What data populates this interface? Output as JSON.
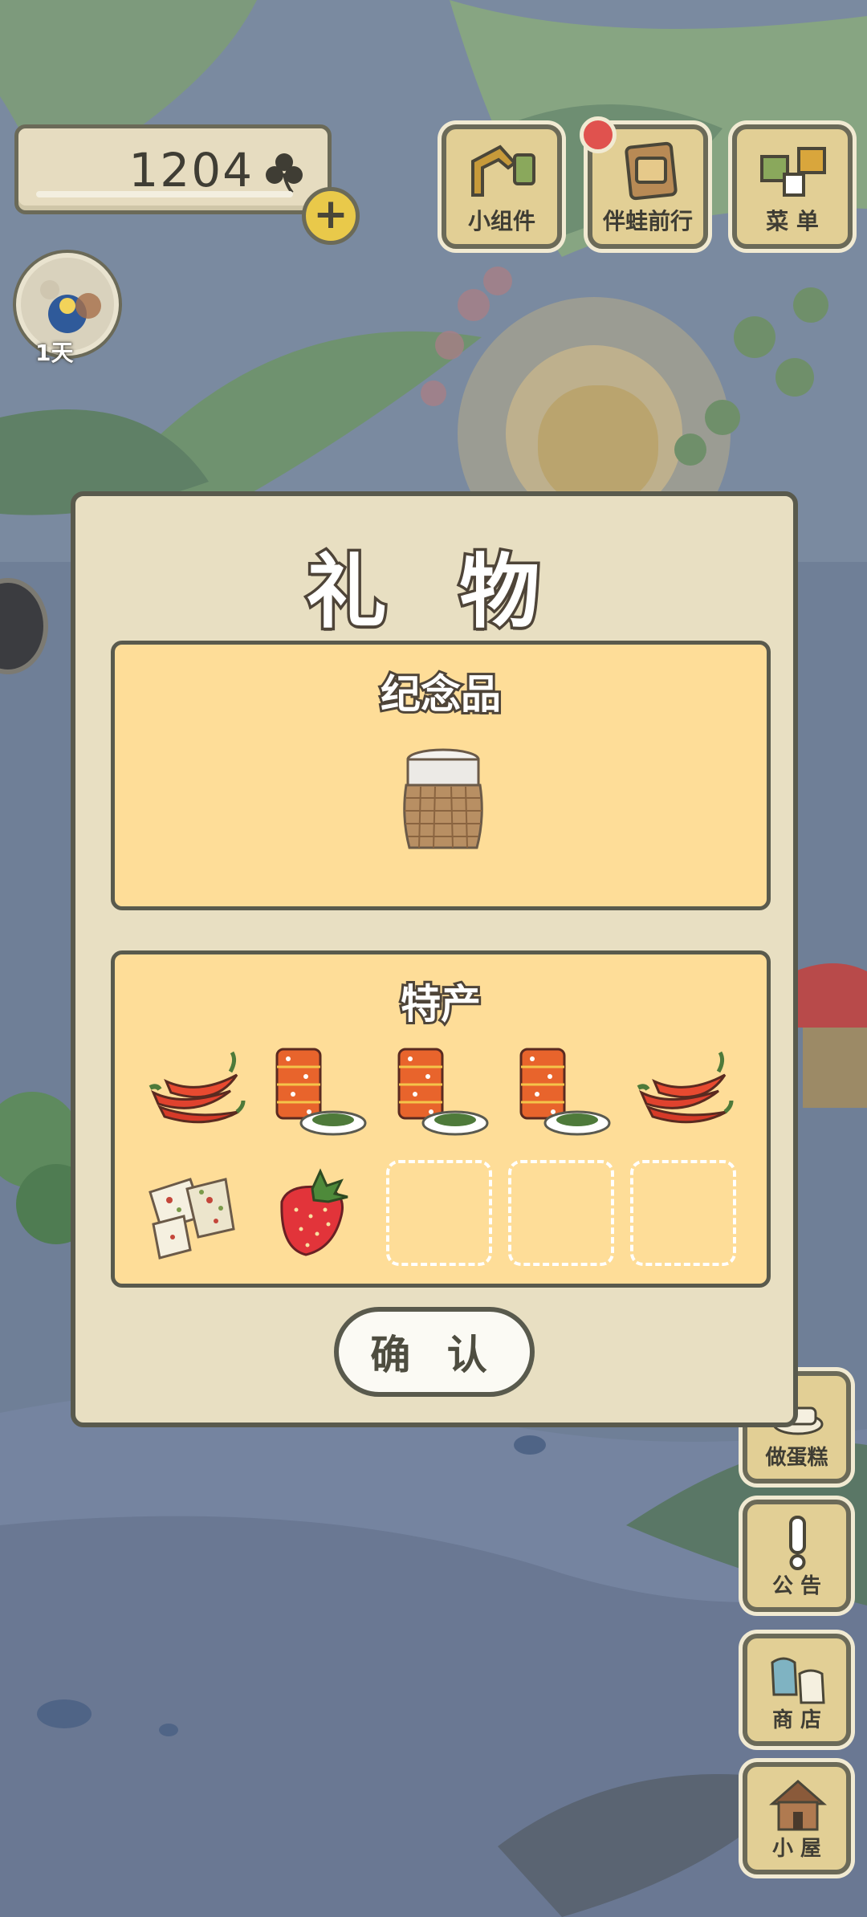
{
  "hud": {
    "clover_count": "1204",
    "clover_icon": "clover-icon",
    "plus_icon": "plus-icon",
    "plus_label": "+",
    "visitor_days": "1天"
  },
  "top_buttons": [
    {
      "label": "小组件",
      "icon": "widget-icon"
    },
    {
      "label": "伴蛙前行",
      "icon": "photo-album-icon"
    },
    {
      "label": "菜 单",
      "icon": "menu-icon"
    }
  ],
  "side_buttons": [
    {
      "label": "做蛋糕",
      "icon": "cake-icon"
    },
    {
      "label": "公 告",
      "icon": "exclamation-icon"
    },
    {
      "label": "商 店",
      "icon": "bags-icon"
    },
    {
      "label": "小 屋",
      "icon": "house-icon"
    }
  ],
  "dialog": {
    "title": "礼 物",
    "souvenir": {
      "title": "纪念品",
      "item_icon": "wicker-cup-icon"
    },
    "specialty": {
      "title": "特产",
      "items": [
        {
          "icon": "chili-peppers-icon"
        },
        {
          "icon": "canned-food-icon"
        },
        {
          "icon": "canned-food-icon"
        },
        {
          "icon": "canned-food-icon"
        },
        {
          "icon": "chili-peppers-icon"
        },
        {
          "icon": "nougat-icon"
        },
        {
          "icon": "strawberry-icon"
        },
        {
          "icon": "empty-slot"
        },
        {
          "icon": "empty-slot"
        },
        {
          "icon": "empty-slot"
        }
      ]
    },
    "confirm_label": "确 认"
  },
  "colors": {
    "dialog_bg": "#e8dfc2",
    "panel_bg": "#fedd98",
    "outline": "#595a4d",
    "button_wood": "#e2cf95",
    "notification": "#e0524e"
  }
}
